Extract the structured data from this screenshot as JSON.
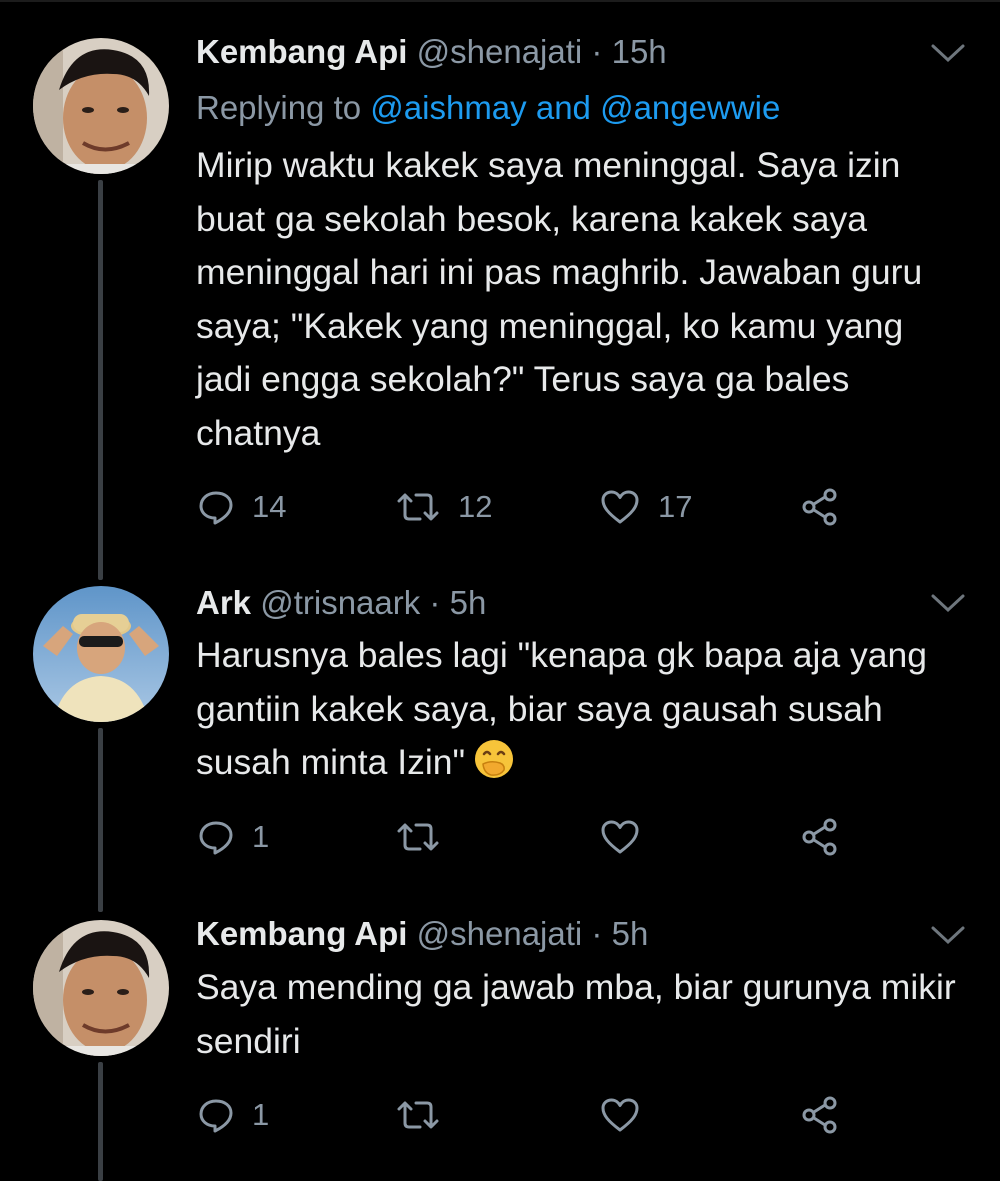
{
  "tweets": [
    {
      "name": "Kembang Api",
      "handle": "@shenajati",
      "separator": "·",
      "time": "15h",
      "replying_prefix": "Replying to",
      "mention1": "@aishmay",
      "mention_joiner": "and",
      "mention2": "@angewwie",
      "text": "Mirip waktu kakek saya meninggal. Saya izin buat ga sekolah besok, karena kakek saya meninggal hari ini pas maghrib. Jawaban guru saya; \"Kakek yang meninggal, ko kamu yang jadi engga sekolah?\" Terus saya ga bales chatnya",
      "replies": "14",
      "retweets": "12",
      "likes": "17"
    },
    {
      "name": "Ark",
      "handle": "@trisnaark",
      "separator": "·",
      "time": "5h",
      "text": "Harusnya bales lagi \"kenapa gk bapa aja yang gantiin kakek saya, biar saya gausah susah susah minta Izin\"",
      "emoji": "face-with-hand-over-mouth",
      "replies": "1",
      "retweets": "",
      "likes": ""
    },
    {
      "name": "Kembang Api",
      "handle": "@shenajati",
      "separator": "·",
      "time": "5h",
      "text": "Saya mending ga jawab mba, biar gurunya mikir sendiri",
      "replies": "1",
      "retweets": "",
      "likes": ""
    }
  ],
  "icons": {
    "reply": "reply-icon",
    "retweet": "retweet-icon",
    "like": "heart-icon",
    "share": "share-icon",
    "more": "chevron-down-icon"
  },
  "colors": {
    "background": "#000000",
    "text": "#e7e9ea",
    "secondary": "#8b98a5",
    "link": "#1d9bf0",
    "thread_line": "#3a3f44"
  }
}
